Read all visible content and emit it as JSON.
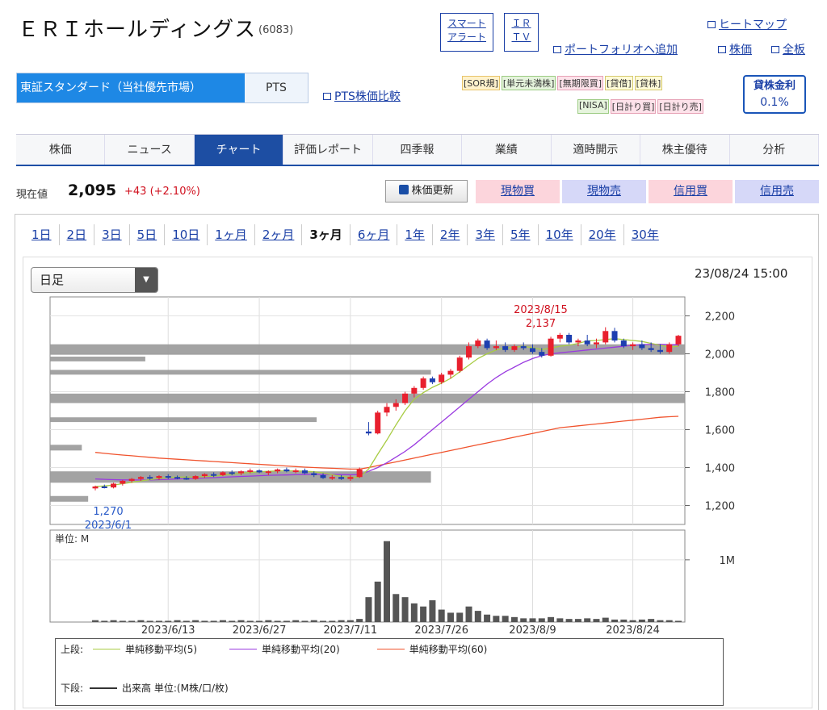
{
  "header": {
    "company_name": "ＥＲＩホールディングス",
    "stock_code": "(6083)",
    "smart_alert": [
      "スマート",
      "アラート"
    ],
    "ir_tv": [
      "ＩＲ",
      "ＴＶ"
    ],
    "heatmap": "ヒートマップ",
    "portfolio": "ポートフォリオへ追加",
    "price": "株価",
    "allboard": "全板"
  },
  "market": {
    "tse": "東証スタンダード（当社優先市場）",
    "pts": "PTS",
    "pts_compare": "PTS株価比較"
  },
  "tags": {
    "row1": [
      "[SOR規]",
      "[単元未満株]",
      "[無期限買]",
      "[貸借]",
      "[貸株]"
    ],
    "row2": [
      "[NISA]",
      "[日計り買]",
      "[日計り売]"
    ]
  },
  "lending": {
    "title": "貸株金利",
    "value": "0.1%"
  },
  "main_tabs": [
    {
      "label": "株価",
      "active": false
    },
    {
      "label": "ニュース",
      "active": false
    },
    {
      "label": "チャート",
      "active": true
    },
    {
      "label": "評価レポート",
      "active": false
    },
    {
      "label": "四季報",
      "active": false
    },
    {
      "label": "業績",
      "active": false
    },
    {
      "label": "適時開示",
      "active": false
    },
    {
      "label": "株主優待",
      "active": false
    },
    {
      "label": "分析",
      "active": false
    }
  ],
  "price": {
    "label": "現在値",
    "value": "2,095",
    "change": "+43 (+2.10%)",
    "update_button": "株価更新",
    "buy": "現物買",
    "sell": "現物売",
    "margin_buy": "信用買",
    "margin_sell": "信用売"
  },
  "periods": [
    {
      "label": "1日",
      "active": false
    },
    {
      "label": "2日",
      "active": false
    },
    {
      "label": "3日",
      "active": false
    },
    {
      "label": "5日",
      "active": false
    },
    {
      "label": "10日",
      "active": false
    },
    {
      "label": "1ヶ月",
      "active": false
    },
    {
      "label": "2ヶ月",
      "active": false
    },
    {
      "label": "3ヶ月",
      "active": true
    },
    {
      "label": "6ヶ月",
      "active": false
    },
    {
      "label": "1年",
      "active": false
    },
    {
      "label": "2年",
      "active": false
    },
    {
      "label": "3年",
      "active": false
    },
    {
      "label": "5年",
      "active": false
    },
    {
      "label": "10年",
      "active": false
    },
    {
      "label": "20年",
      "active": false
    },
    {
      "label": "30年",
      "active": false
    }
  ],
  "chart": {
    "interval": "日足",
    "timestamp": "23/08/24 15:00",
    "volume_unit_label": "単位: M",
    "volume_tick": "1M",
    "legend": {
      "upper_label": "上段:",
      "lower_label": "下段:",
      "ma5": "単純移動平均(5)",
      "ma20": "単純移動平均(20)",
      "ma60": "単純移動平均(60)",
      "volume": "出来高 単位:(M株/口/枚)"
    }
  },
  "colors": {
    "up": "#e8202e",
    "down": "#1e3fb0",
    "ma5": "#a8cc44",
    "ma20": "#9a3ae0",
    "ma60": "#f0532d",
    "volume_bar": "#555555",
    "price_band": "#999999"
  },
  "chart_data": {
    "type": "candlestick",
    "price_axis": {
      "ylim": [
        1100,
        2300
      ],
      "ticks": [
        "1,200",
        "1,400",
        "1,600",
        "1,800",
        "2,000",
        "2,200"
      ],
      "tick_values": [
        1200,
        1400,
        1600,
        1800,
        2000,
        2200
      ]
    },
    "x_ticks": [
      "2023/6/13",
      "2023/6/27",
      "2023/7/11",
      "2023/7/26",
      "2023/8/9",
      "2023/8/24"
    ],
    "x_tick_index": [
      8,
      18,
      28,
      38,
      48,
      59
    ],
    "annotations": [
      {
        "index": 48,
        "label_date": "2023/8/15",
        "label_value": "2,137",
        "value": 2137
      },
      {
        "index": 0,
        "label_date": "2023/6/1",
        "label_value": "1,270",
        "value": 1270
      }
    ],
    "candles": [
      [
        1290,
        1305,
        1280,
        1300
      ],
      [
        1300,
        1310,
        1290,
        1295
      ],
      [
        1295,
        1320,
        1290,
        1315
      ],
      [
        1315,
        1335,
        1305,
        1330
      ],
      [
        1330,
        1345,
        1320,
        1340
      ],
      [
        1340,
        1355,
        1330,
        1350
      ],
      [
        1350,
        1360,
        1335,
        1345
      ],
      [
        1345,
        1360,
        1335,
        1355
      ],
      [
        1355,
        1365,
        1340,
        1350
      ],
      [
        1350,
        1358,
        1338,
        1345
      ],
      [
        1345,
        1355,
        1335,
        1340
      ],
      [
        1340,
        1360,
        1335,
        1355
      ],
      [
        1355,
        1370,
        1345,
        1365
      ],
      [
        1365,
        1375,
        1350,
        1360
      ],
      [
        1360,
        1380,
        1355,
        1375
      ],
      [
        1375,
        1385,
        1360,
        1370
      ],
      [
        1370,
        1385,
        1360,
        1380
      ],
      [
        1380,
        1395,
        1370,
        1385
      ],
      [
        1385,
        1390,
        1370,
        1375
      ],
      [
        1375,
        1385,
        1360,
        1380
      ],
      [
        1380,
        1395,
        1370,
        1390
      ],
      [
        1390,
        1400,
        1375,
        1380
      ],
      [
        1380,
        1395,
        1370,
        1385
      ],
      [
        1385,
        1395,
        1365,
        1370
      ],
      [
        1370,
        1380,
        1350,
        1360
      ],
      [
        1360,
        1370,
        1340,
        1345
      ],
      [
        1345,
        1360,
        1335,
        1350
      ],
      [
        1350,
        1360,
        1335,
        1340
      ],
      [
        1340,
        1360,
        1330,
        1350
      ],
      [
        1350,
        1400,
        1345,
        1390
      ],
      [
        1590,
        1640,
        1570,
        1580
      ],
      [
        1580,
        1700,
        1575,
        1690
      ],
      [
        1690,
        1740,
        1670,
        1720
      ],
      [
        1720,
        1760,
        1700,
        1740
      ],
      [
        1740,
        1800,
        1730,
        1790
      ],
      [
        1790,
        1830,
        1770,
        1820
      ],
      [
        1820,
        1880,
        1810,
        1870
      ],
      [
        1870,
        1880,
        1840,
        1850
      ],
      [
        1850,
        1900,
        1840,
        1890
      ],
      [
        1890,
        1920,
        1870,
        1910
      ],
      [
        1910,
        1990,
        1900,
        1980
      ],
      [
        1980,
        2060,
        1970,
        2040
      ],
      [
        2040,
        2080,
        2030,
        2070
      ],
      [
        2070,
        2080,
        2020,
        2030
      ],
      [
        2030,
        2070,
        2020,
        2040
      ],
      [
        2040,
        2060,
        2010,
        2020
      ],
      [
        2020,
        2050,
        2010,
        2040
      ],
      [
        2040,
        2060,
        2020,
        2030
      ],
      [
        2030,
        2050,
        2000,
        2010
      ],
      [
        2010,
        2030,
        1980,
        1990
      ],
      [
        1990,
        2090,
        1985,
        2080
      ],
      [
        2080,
        2110,
        2060,
        2100
      ],
      [
        2100,
        2110,
        2050,
        2060
      ],
      [
        2060,
        2080,
        2040,
        2070
      ],
      [
        2070,
        2100,
        2040,
        2050
      ],
      [
        2050,
        2080,
        2030,
        2060
      ],
      [
        2060,
        2140,
        2050,
        2120
      ],
      [
        2120,
        2137,
        2060,
        2070
      ],
      [
        2070,
        2080,
        2030,
        2040
      ],
      [
        2040,
        2060,
        2020,
        2050
      ],
      [
        2050,
        2070,
        2020,
        2030
      ],
      [
        2030,
        2060,
        2010,
        2020
      ],
      [
        2020,
        2050,
        2000,
        2010
      ],
      [
        2010,
        2060,
        2000,
        2050
      ],
      [
        2050,
        2100,
        2040,
        2095
      ]
    ],
    "ma5": [
      1300,
      1303,
      1308,
      1315,
      1322,
      1330,
      1336,
      1342,
      1348,
      1350,
      1350,
      1350,
      1352,
      1355,
      1360,
      1365,
      1370,
      1374,
      1378,
      1380,
      1382,
      1383,
      1382,
      1381,
      1378,
      1372,
      1362,
      1353,
      1348,
      1350,
      1392,
      1470,
      1545,
      1625,
      1700,
      1760,
      1795,
      1823,
      1845,
      1870,
      1905,
      1940,
      1975,
      2000,
      2020,
      2030,
      2035,
      2040,
      2032,
      2022,
      2030,
      2040,
      2045,
      2055,
      2068,
      2070,
      2075,
      2080,
      2075,
      2070,
      2065,
      2055,
      2045,
      2035,
      2040
    ],
    "ma20": [
      1340,
      1338,
      1336,
      1335,
      1335,
      1334,
      1335,
      1336,
      1338,
      1340,
      1342,
      1343,
      1345,
      1347,
      1349,
      1351,
      1353,
      1355,
      1357,
      1359,
      1360,
      1361,
      1362,
      1363,
      1364,
      1364,
      1364,
      1363,
      1362,
      1363,
      1380,
      1400,
      1425,
      1455,
      1485,
      1520,
      1560,
      1600,
      1640,
      1680,
      1720,
      1760,
      1800,
      1840,
      1875,
      1905,
      1930,
      1955,
      1975,
      1990,
      2000,
      2005,
      2010,
      2015,
      2020,
      2025,
      2030,
      2035,
      2040,
      2045,
      2048,
      2050,
      2050,
      2048,
      2048
    ],
    "ma60": [
      1480,
      1475,
      1470,
      1466,
      1462,
      1458,
      1454,
      1450,
      1447,
      1444,
      1441,
      1438,
      1435,
      1432,
      1429,
      1426,
      1423,
      1420,
      1417,
      1414,
      1411,
      1408,
      1405,
      1402,
      1400,
      1398,
      1396,
      1394,
      1392,
      1392,
      1400,
      1410,
      1420,
      1430,
      1440,
      1450,
      1460,
      1470,
      1480,
      1490,
      1500,
      1510,
      1520,
      1530,
      1540,
      1550,
      1560,
      1570,
      1580,
      1590,
      1600,
      1610,
      1615,
      1620,
      1625,
      1630,
      1635,
      1640,
      1645,
      1650,
      1655,
      1660,
      1665,
      1668,
      1670
    ],
    "price_bands": [
      {
        "from": 1995,
        "to": 2050,
        "extent": 1.0
      },
      {
        "from": 1960,
        "to": 1985,
        "extent": 0.15
      },
      {
        "from": 1890,
        "to": 1915,
        "extent": 0.6
      },
      {
        "from": 1740,
        "to": 1790,
        "extent": 1.0
      },
      {
        "from": 1640,
        "to": 1665,
        "extent": 0.42
      },
      {
        "from": 1490,
        "to": 1520,
        "extent": 0.05
      },
      {
        "from": 1320,
        "to": 1380,
        "extent": 0.6
      },
      {
        "from": 1220,
        "to": 1250,
        "extent": 0.06
      }
    ],
    "volume": {
      "unit": "M",
      "ylim": [
        0,
        1.4
      ],
      "values": [
        0.03,
        0.02,
        0.03,
        0.02,
        0.02,
        0.03,
        0.02,
        0.02,
        0.02,
        0.03,
        0.02,
        0.03,
        0.02,
        0.02,
        0.03,
        0.02,
        0.03,
        0.02,
        0.02,
        0.03,
        0.02,
        0.02,
        0.03,
        0.02,
        0.03,
        0.02,
        0.02,
        0.03,
        0.03,
        0.05,
        0.4,
        0.65,
        1.3,
        0.45,
        0.4,
        0.3,
        0.25,
        0.35,
        0.2,
        0.15,
        0.15,
        0.25,
        0.18,
        0.12,
        0.1,
        0.1,
        0.08,
        0.06,
        0.06,
        0.06,
        0.08,
        0.06,
        0.05,
        0.05,
        0.06,
        0.05,
        0.07,
        0.04,
        0.04,
        0.03,
        0.04,
        0.05,
        0.03,
        0.03,
        0.02
      ]
    }
  }
}
